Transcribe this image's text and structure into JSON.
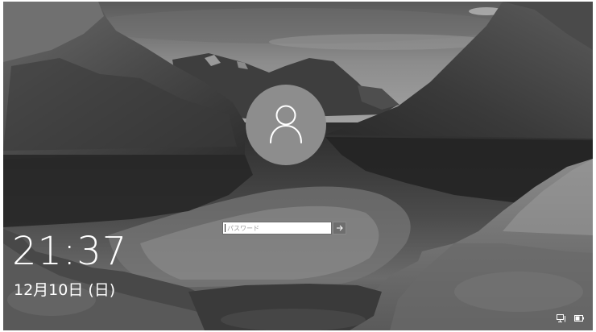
{
  "lock_screen": {
    "time": "21:37",
    "date": "12月10日 (日)"
  },
  "sign_in": {
    "password_placeholder": "パスワード",
    "password_value": "",
    "submit_icon": "arrow-right-icon",
    "user_icon": "user-icon"
  },
  "tray": {
    "network_icon": "network-icon",
    "power_icon": "power-icon"
  },
  "colors": {
    "avatar": "#8d8d8d",
    "submit": "#6e6e6e",
    "text": "#ffffff"
  }
}
